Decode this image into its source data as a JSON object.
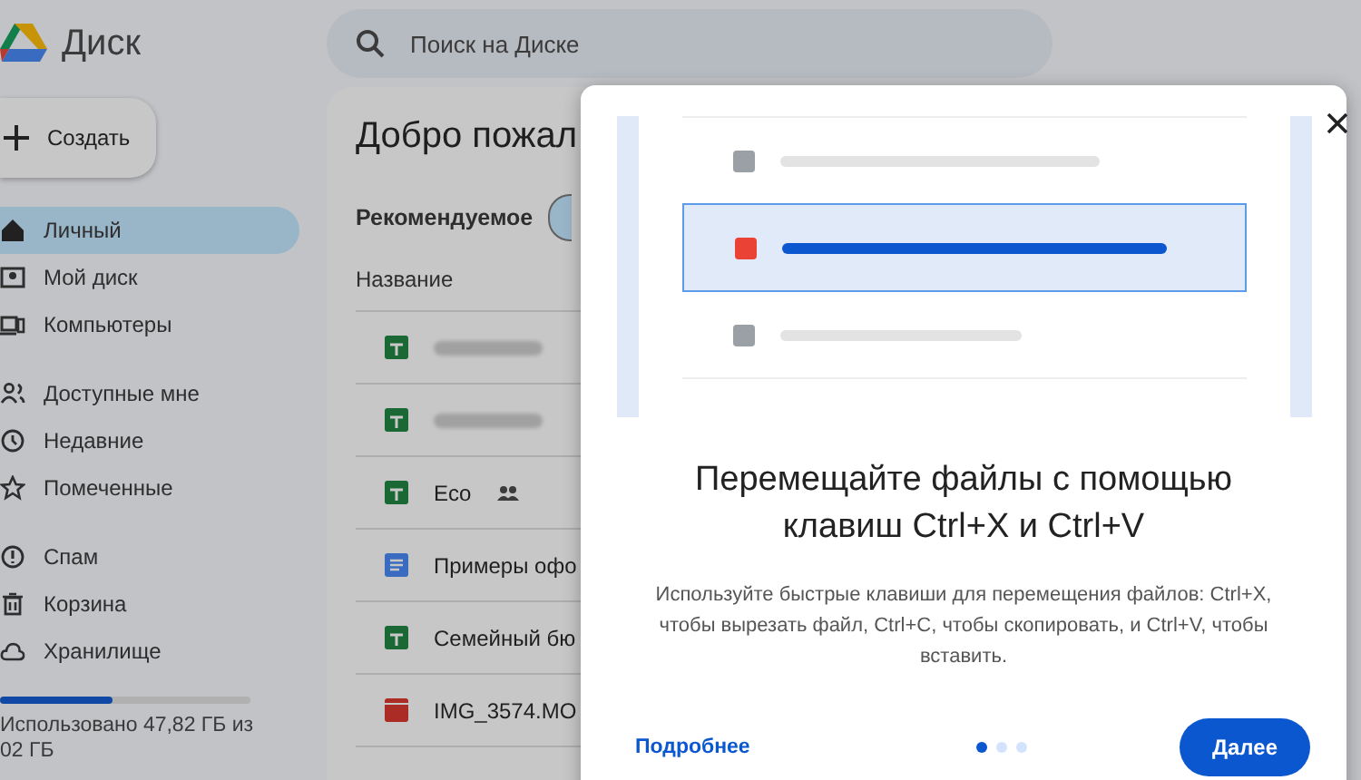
{
  "app": {
    "title": "Диск"
  },
  "search": {
    "placeholder": "Поиск на Диске"
  },
  "create_button": {
    "label": "Создать"
  },
  "sidebar": {
    "groups": [
      [
        {
          "label": "Личный",
          "selected": true
        },
        {
          "label": "Мой диск",
          "selected": false
        },
        {
          "label": "Компьютеры",
          "selected": false
        }
      ],
      [
        {
          "label": "Доступные мне",
          "selected": false
        },
        {
          "label": "Недавние",
          "selected": false
        },
        {
          "label": "Помеченные",
          "selected": false
        }
      ],
      [
        {
          "label": "Спам",
          "selected": false
        },
        {
          "label": "Корзина",
          "selected": false
        },
        {
          "label": "Хранилище",
          "selected": false
        }
      ]
    ]
  },
  "storage": {
    "level": 0.45,
    "text": "Использовано 47,82 ГБ из 02 ГБ"
  },
  "main": {
    "title": "Добро пожал",
    "recommended": "Рекомендуемое",
    "column": "Название",
    "rows": [
      {
        "kind": "sheet",
        "name": "",
        "shared": false
      },
      {
        "kind": "sheet",
        "name": "",
        "shared": false
      },
      {
        "kind": "sheet",
        "name": "Eco",
        "shared": true
      },
      {
        "kind": "doc",
        "name": "Примеры офо",
        "shared": false
      },
      {
        "kind": "sheet",
        "name": "Семейный бю",
        "shared": false
      },
      {
        "kind": "video",
        "name": "IMG_3574.MO",
        "shared": false
      }
    ]
  },
  "dialog": {
    "title": "Перемещайте файлы с помощью клавиш Ctrl+X и Ctrl+V",
    "body": "Используйте быстрые клавиши для перемещения файлов: Ctrl+X, чтобы вырезать файл, Ctrl+C, чтобы скопировать, и Ctrl+V, чтобы вставить.",
    "link": "Подробнее",
    "pages": [
      {
        "selected": true
      },
      {
        "selected": false
      },
      {
        "selected": false
      }
    ],
    "next": "Далее"
  }
}
